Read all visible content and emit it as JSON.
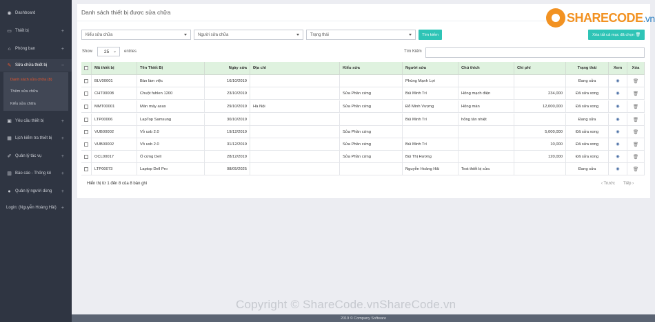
{
  "sidebar": {
    "items": [
      {
        "label": "Dashboard",
        "icon": "dashboard-icon",
        "glyph": "◉",
        "plus": ""
      },
      {
        "label": "Thiết bị",
        "icon": "laptop-icon",
        "glyph": "▭",
        "plus": "+"
      },
      {
        "label": "Phòng ban",
        "icon": "home-icon",
        "glyph": "⌂",
        "plus": "+"
      },
      {
        "label": "Sửa chữa thiết bị",
        "icon": "wrench-icon",
        "glyph": "✎",
        "plus": "−"
      },
      {
        "label": "Yêu cầu thiết bị",
        "icon": "truck-icon",
        "glyph": "▣",
        "plus": "+"
      },
      {
        "label": "Lịch kiểm tra thiết bị",
        "icon": "calendar-icon",
        "glyph": "▦",
        "plus": "+"
      },
      {
        "label": "Quản lý tác vụ",
        "icon": "pencil-icon",
        "glyph": "✐",
        "plus": "+"
      },
      {
        "label": "Báo cáo - Thống kê",
        "icon": "chart-icon",
        "glyph": "▥",
        "plus": "+"
      },
      {
        "label": "Quản lý người dùng",
        "icon": "user-icon",
        "glyph": "●",
        "plus": "+"
      },
      {
        "label": "Login: (Nguyễn Hoàng Hải)",
        "icon": "",
        "glyph": "",
        "plus": "+"
      }
    ],
    "sub_items": [
      {
        "label": "Danh sách sửa chữa (8)"
      },
      {
        "label": "Thêm sửa chữa"
      },
      {
        "label": "Kiểu sửa chữa"
      }
    ]
  },
  "page": {
    "title": "Danh sách thiết bị được sửa chữa"
  },
  "filters": {
    "type": "Kiểu sửa chữa",
    "person": "Người sửa chữa",
    "status": "Trạng thái",
    "search_button": "Tìm kiếm",
    "delete_button": "Xóa tất cả mục đã chọn 🗑"
  },
  "table_controls": {
    "show_label": "Show",
    "entries_value": "25",
    "entries_label": "entries",
    "search_label": "Tìm Kiếm"
  },
  "table": {
    "columns": [
      "",
      "Mã thiết bị",
      "Tên Thiết Bị",
      "Ngày sửa",
      "Địa chỉ",
      "Kiểu sửa",
      "Người sửa",
      "Chú thích",
      "Chi phí",
      "Trạng thái",
      "Xem",
      "Xóa"
    ],
    "rows": [
      [
        "BLV00001",
        "Bàn làm việc",
        "16/10/2019",
        "",
        "",
        "Phùng Mạnh Lợi",
        "",
        "",
        "Đang sửa"
      ],
      [
        "CHT00008",
        "Chuột fuhlen 1200",
        "23/10/2019",
        "",
        "Sửa Phần cứng",
        "Bùi Minh Trí",
        "Hỏng mạch điện",
        "234,000",
        "Đã sửa xong"
      ],
      [
        "MMT00001",
        "Màn máy asus",
        "29/10/2019",
        "Hà Nội",
        "Sửa Phần cứng",
        "Đỗ Minh Vượng",
        "Hỏng màn",
        "12,000,000",
        "Đã sửa xong"
      ],
      [
        "LTP00006",
        "LapTop Samsung",
        "30/10/2019",
        "",
        "",
        "Bùi Minh Trí",
        "hỏng tản nhiệt",
        "",
        "Đang sửa"
      ],
      [
        "VUB00002",
        "Vỏ usb 2.0",
        "19/12/2019",
        "",
        "Sửa Phần cứng",
        "",
        "",
        "5,000,000",
        "Đã sửa xong"
      ],
      [
        "VUB00002",
        "Vỏ usb 2.0",
        "31/12/2019",
        "",
        "Sửa Phần cứng",
        "Bùi Minh Trí",
        "",
        "10,000",
        "Đã sửa xong"
      ],
      [
        "OCL00017",
        "Ổ cứng Dell",
        "28/12/2019",
        "",
        "Sửa Phần cứng",
        "Bùi Thị Hương",
        "",
        "120,000",
        "Đã sửa xong"
      ],
      [
        "LTP00073",
        "Laptop Dell Pro",
        "08/05/2025",
        "",
        "",
        "Nguyễn Hoàng Hải",
        "Test thiết bị sửa",
        "",
        "Đang sửa"
      ]
    ],
    "info": "Hiển thị từ 1 đến 8 của 8 bản ghi",
    "prev": "‹ Trước",
    "next": "Tiếp ›"
  },
  "logo": {
    "text": "SHARECODE",
    "suffix": ".vn"
  },
  "watermark": "Copyright © ShareCode.vnShareCode.vn",
  "footer": "2019 © Company Software",
  "colors": {
    "sidebar": "#2f3542",
    "accent": "#e8562d",
    "button": "#2ec4b6",
    "table_head": "#dff2df"
  }
}
